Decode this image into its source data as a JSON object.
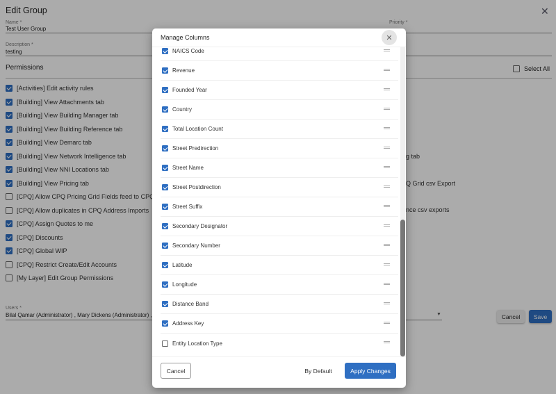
{
  "page": {
    "title": "Edit Group",
    "name_label": "Name *",
    "name_value": "Test User Group",
    "priority_label": "Priority *",
    "description_label": "Description *",
    "description_value": "testing",
    "permissions_title": "Permissions",
    "select_all": "Select All",
    "permissions": [
      {
        "label": "[Activities] Edit activity rules",
        "checked": true
      },
      {
        "label": "[Building] View Attachments tab",
        "checked": true
      },
      {
        "label": "[Building] View Building Manager tab",
        "checked": true
      },
      {
        "label": "[Building] View Building Reference tab",
        "checked": true
      },
      {
        "label": "[Building] View Demarc tab",
        "checked": true
      },
      {
        "label": "[Building] View Network Intelligence tab",
        "checked": true
      },
      {
        "label": "[Building] View NNI Locations tab",
        "checked": true
      },
      {
        "label": "[Building] View Pricing tab",
        "checked": true
      },
      {
        "label": "[CPQ] Allow CPQ Pricing Grid Fields feed to CPQ Grid v",
        "checked": false
      },
      {
        "label": "[CPQ] Allow duplicates in CPQ Address Imports",
        "checked": false
      },
      {
        "label": "[CPQ] Assign Quotes to me",
        "checked": true
      },
      {
        "label": "[CPQ] Discounts",
        "checked": true
      },
      {
        "label": "[CPQ] Global WIP",
        "checked": true
      },
      {
        "label": "[CPQ] Restrict Create/Edit Accounts",
        "checked": false
      },
      {
        "label": "[My Layer] Edit Group Permissions",
        "checked": false
      }
    ],
    "right_fragments": [
      "g tab",
      "Q Grid csv Export",
      "nce csv exports"
    ],
    "users_label": "Users *",
    "users_value": "Bilal Qamar (Administrator) , Mary Dickens (Administrator) , San",
    "cancel": "Cancel",
    "save": "Save"
  },
  "modal": {
    "title": "Manage Columns",
    "columns": [
      {
        "label": "NAICS Code",
        "checked": true
      },
      {
        "label": "Revenue",
        "checked": true
      },
      {
        "label": "Founded Year",
        "checked": true
      },
      {
        "label": "Country",
        "checked": true
      },
      {
        "label": "Total Location Count",
        "checked": true
      },
      {
        "label": "Street Predirection",
        "checked": true
      },
      {
        "label": "Street Name",
        "checked": true
      },
      {
        "label": "Street Postdirection",
        "checked": true
      },
      {
        "label": "Street Suffix",
        "checked": true
      },
      {
        "label": "Secondary Designator",
        "checked": true
      },
      {
        "label": "Secondary Number",
        "checked": true
      },
      {
        "label": "Latitude",
        "checked": true
      },
      {
        "label": "Longitude",
        "checked": true
      },
      {
        "label": "Distance Band",
        "checked": true
      },
      {
        "label": "Address Key",
        "checked": true
      },
      {
        "label": "Entity Location Type",
        "checked": false
      }
    ],
    "cancel": "Cancel",
    "by_default": "By Default",
    "apply": "Apply Changes"
  },
  "colors": {
    "primary": "#2f6fc2"
  }
}
